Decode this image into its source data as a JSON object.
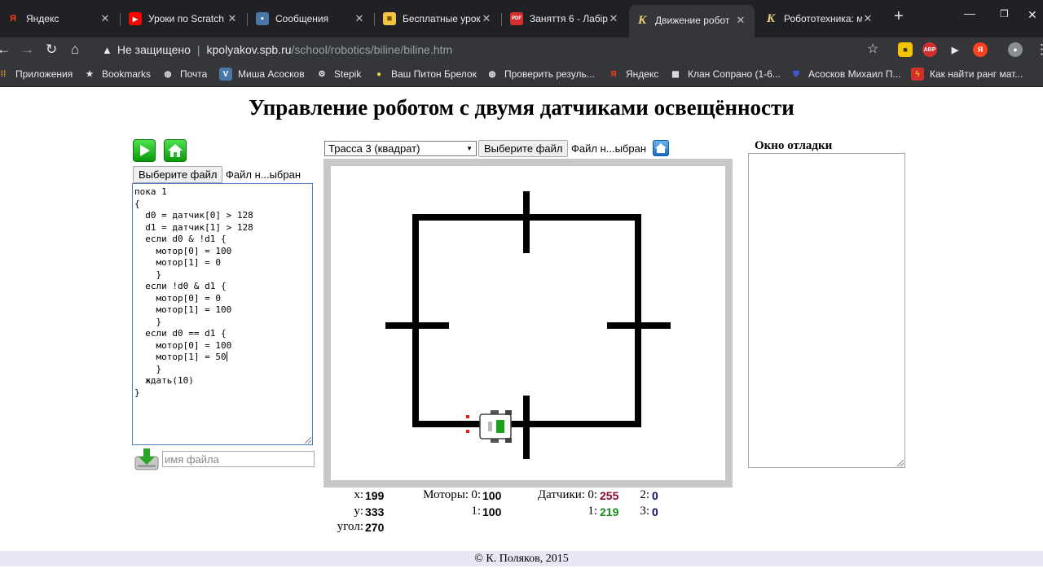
{
  "browser": {
    "tabs": [
      {
        "title": "Яндекс",
        "favicon_text": "Я",
        "favicon_color": "#fc3f1d"
      },
      {
        "title": "Уроки по Scratch",
        "favicon_text": "▶",
        "favicon_color": "#ff0000"
      },
      {
        "title": "Сообщения",
        "favicon_text": "▪",
        "favicon_color": "#4a76a8"
      },
      {
        "title": "Бесплатные урок",
        "favicon_text": "■",
        "favicon_color": "#f4c542"
      },
      {
        "title": "Заняття 6 - Лабір",
        "favicon_text": "PDF",
        "favicon_color": "#d32f2f"
      },
      {
        "title": "Движение робот",
        "favicon_text": "K",
        "favicon_color": "#35363a"
      },
      {
        "title": "Робототехника: м",
        "favicon_text": "K",
        "favicon_color": "#202124"
      }
    ],
    "new_tab": "+",
    "address": {
      "security": "Не защищено",
      "host": "kpolyakov.spb.ru",
      "path": "/school/robotics/biline/biline.htm"
    },
    "bookmarks": [
      {
        "label": "Приложения",
        "icon": "apps-grid-icon"
      },
      {
        "label": "Bookmarks",
        "icon": "star-icon"
      },
      {
        "label": "Почта",
        "icon": "globe-icon"
      },
      {
        "label": "Миша Асосков",
        "icon": "vk-icon"
      },
      {
        "label": "Stepik",
        "icon": "stepik-icon"
      },
      {
        "label": "Ваш Питон Брелок",
        "icon": "circle-icon"
      },
      {
        "label": "Проверить резуль...",
        "icon": "globe-icon"
      },
      {
        "label": "Яндекс",
        "icon": "yandex-icon"
      },
      {
        "label": "Клан Сопрано (1-6...",
        "icon": "film-icon"
      },
      {
        "label": "Асосков Михаил П...",
        "icon": "shield-icon"
      },
      {
        "label": "Как найти ранг мат...",
        "icon": "bolt-icon"
      }
    ]
  },
  "page": {
    "title": "Управление роботом с двумя датчиками освещённости",
    "left": {
      "choose_file": "Выберите файл",
      "file_status": "Файл н...ыбран",
      "code_lines": [
        "пока 1",
        "{",
        "  d0 = датчик[0] > 128",
        "  d1 = датчик[1] > 128",
        "  если d0 & !d1 {",
        "    мотор[0] = 100",
        "    мотор[1] = 0",
        "    }",
        "  если !d0 & d1 {",
        "    мотор[0] = 0",
        "    мотор[1] = 100",
        "    }",
        "  если d0 == d1 {",
        "    мотор[0] = 100",
        "    мотор[1] = 50",
        "    }",
        "  ждать(10)",
        "}"
      ],
      "filename_placeholder": "имя файла"
    },
    "center": {
      "track_selected": "Трасса 3 (квадрат)",
      "choose_file": "Выберите файл",
      "file_status": "Файл н...ыбран"
    },
    "debug": {
      "title": "Окно отладки"
    },
    "stats": {
      "x_label": "x:",
      "x": "199",
      "y_label": "y:",
      "y": "333",
      "angle_label": "угол:",
      "angle": "270",
      "motors_label": "Моторы:",
      "motor0_label": "0:",
      "motor0": "100",
      "motor1_label": "1:",
      "motor1": "100",
      "sensors_label": "Датчики:",
      "sensor0_label": "0:",
      "sensor0": "255",
      "sensor1_label": "1:",
      "sensor1": "219",
      "sensor2_label": "2:",
      "sensor2": "0",
      "sensor3_label": "3:",
      "sensor3": "0"
    },
    "footer": "© К. Поляков, 2015"
  },
  "colors": {
    "sensor0": "#8b0a2a",
    "sensor1": "#1a8a1a",
    "sensor_other": "#0a0a6a",
    "track": "#000000",
    "sensor_marker": "#e02020"
  }
}
